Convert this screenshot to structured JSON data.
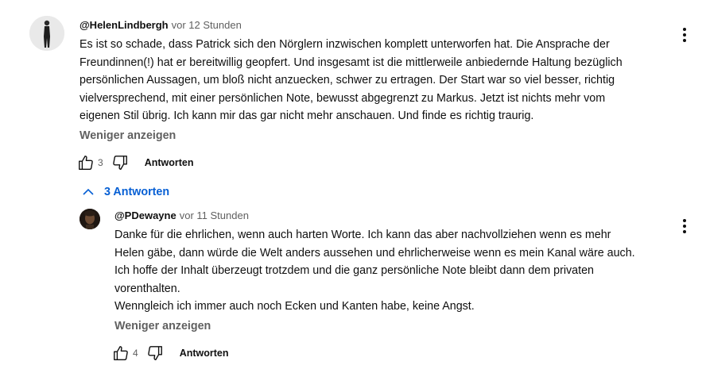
{
  "comment": {
    "author": "@HelenLindbergh",
    "time": "vor 12 Stunden",
    "lines": [
      "Es ist so schade, dass Patrick sich den Nörglern inzwischen komplett unterworfen hat. Die Ansprache der",
      "Freundinnen(!) hat er bereitwillig geopfert. Und insgesamt ist die mittlerweile anbiedernde Haltung bezüglich",
      "persönlichen Aussagen, um bloß nicht anzuecken, schwer zu ertragen. Der Start war so viel besser, richtig",
      "vielversprechend, mit einer persönlichen Note, bewusst abgegrenzt zu Markus. Jetzt ist nichts mehr vom",
      "eigenen Stil übrig. Ich kann mir das gar nicht mehr anschauen. Und finde es richtig traurig."
    ],
    "show_less": "Weniger anzeigen",
    "likes": "3",
    "reply_label": "Antworten"
  },
  "replies_toggle": {
    "label": "3 Antworten"
  },
  "reply": {
    "author": "@PDewayne",
    "time": "vor 11 Stunden",
    "lines": [
      "Danke für die ehrlichen, wenn auch harten Worte. Ich kann das aber nachvollziehen wenn es mehr",
      "Helen gäbe, dann würde die Welt anders aussehen und ehrlicherweise wenn es mein Kanal wäre auch.",
      "Ich hoffe der Inhalt überzeugt trotzdem und die ganz persönliche Note bleibt dann dem privaten",
      "vorenthalten.",
      "Wenngleich ich immer auch noch Ecken und Kanten habe, keine Angst."
    ],
    "show_less": "Weniger anzeigen",
    "likes": "4",
    "reply_label": "Antworten"
  },
  "icons": [
    "like-icon",
    "dislike-icon",
    "more-vert-icon",
    "chevron-up-icon"
  ],
  "colors": {
    "link": "#065fd4",
    "secondary_text": "#606060",
    "primary_text": "#0f0f0f"
  }
}
